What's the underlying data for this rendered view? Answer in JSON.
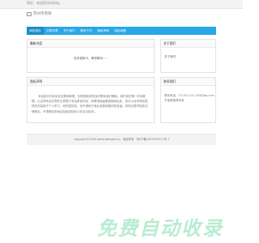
{
  "topbar": {
    "text": "您好，欢迎您访问本站。"
  },
  "header": {
    "logo_alt": "苏州市贤阳"
  },
  "nav": {
    "items": [
      {
        "label": "网站首页"
      },
      {
        "label": "文章列表"
      },
      {
        "label": "关于我们"
      },
      {
        "label": "联系方式"
      },
      {
        "label": "隐私声明"
      },
      {
        "label": "网站地图"
      }
    ]
  },
  "latest": {
    "title": "最新内容",
    "empty_message": "没有更新中，敬请期待~~"
  },
  "about": {
    "title": "关于我们",
    "text": "关于我们"
  },
  "notice": {
    "title": "隐私声明",
    "text": "本站部分内容来自互联网转载，如有侵权请您及时联系我们删除。我们将在第一时间处理。凡注明本站文章的文章属于本站原创作品，转载请保留原链接和出处。您可以对本网站提供的内容用于个人学习、研究或欣赏，但不得用于商业或其他营利性用途。同时应遵守相关法律规定，不得侵犯本网站及相关权利人的合法权利。"
  },
  "contact": {
    "title": "联系我们",
    "email": "联系电话：23.205.141   163@qq.com",
    "note": "不接受推荐收录"
  },
  "footer": {
    "copyright": "copyright©2020 www.sdongtai.cn",
    "sitemap": "版权所有",
    "icp": "鲁ICP备2022099117号-1"
  },
  "watermark": {
    "text": "免费自动收录"
  },
  "colors": {
    "nav_bg": "#29a7e8",
    "nav_active": "#1a8ccb",
    "watermark": "#b9ecd0"
  }
}
